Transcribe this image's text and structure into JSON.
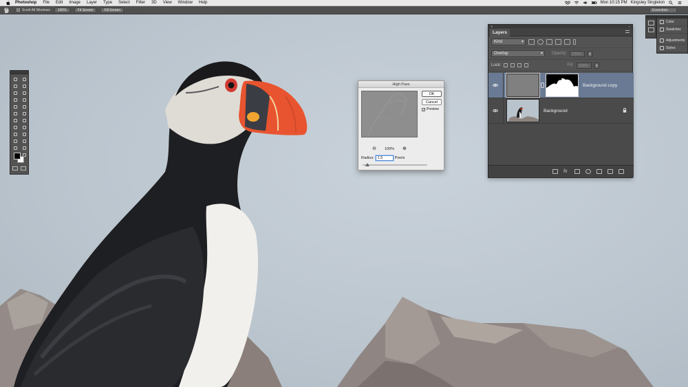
{
  "menubar": {
    "app_name": "Photoshop",
    "menus": [
      "File",
      "Edit",
      "Image",
      "Layer",
      "Type",
      "Select",
      "Filter",
      "3D",
      "View",
      "Window",
      "Help"
    ],
    "clock": "Mon 10:15 PM",
    "user": "Kingsley Singleton",
    "status_icons": [
      "dropbox-icon",
      "wifi-icon",
      "volume-icon",
      "battery-icon"
    ]
  },
  "optionsbar": {
    "tool_icon": "hand-tool-icon",
    "scroll_all_label": "Scroll All Windows",
    "btn_100": "100%",
    "btn_fit": "Fit Screen",
    "btn_fill": "Fill Screen",
    "workspace": "Essentials"
  },
  "dialog": {
    "title": "High Pass",
    "ok": "OK",
    "cancel": "Cancel",
    "preview_label": "Preview",
    "preview_checked": true,
    "zoom": "100%",
    "radius_label": "Radius:",
    "radius_value": "1.5",
    "radius_unit": "Pixels",
    "radius_slider_fraction": 0.05
  },
  "sidepanel": {
    "items": [
      "Color",
      "Swatches",
      "Adjustments",
      "Styles"
    ]
  },
  "layers": {
    "tab_label": "Layers",
    "filter_kind": "Kind",
    "blend_mode": "Overlay",
    "opacity_label": "Opacity:",
    "opacity_value": "100%",
    "lock_label": "Lock:",
    "fill_label": "Fill:",
    "fill_value": "100%",
    "items": [
      {
        "name": "Background copy",
        "selected": true,
        "visible": true
      },
      {
        "name": "Background",
        "selected": false,
        "visible": true,
        "locked": true
      }
    ]
  },
  "colors": {
    "selected_layer": "#6a7a94",
    "panel_bg": "#535353",
    "canvas_bg": "#bcc6cf"
  }
}
